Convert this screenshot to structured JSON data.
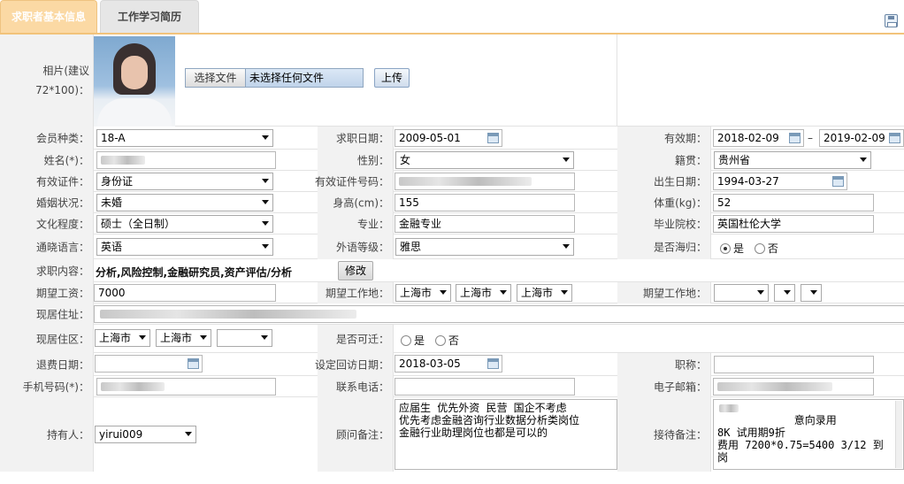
{
  "tabs": {
    "active": "求职者基本信息",
    "inactive": "工作学习简历"
  },
  "photo": {
    "label": "相片(建议72*100)：",
    "choose_button": "选择文件",
    "no_file": "未选择任何文件",
    "upload_button": "上传"
  },
  "labels": {
    "member_type": "会员种类：",
    "job_date": "求职日期：",
    "valid_period": "有效期：",
    "name": "姓名(*)：",
    "gender": "性别：",
    "origin": "籍贯：",
    "id_type": "有效证件：",
    "id_number": "有效证件号码：",
    "birth": "出生日期：",
    "marital": "婚姻状况：",
    "height": "身高(cm)：",
    "weight": "体重(kg)：",
    "education": "文化程度：",
    "major": "专业：",
    "school": "毕业院校：",
    "language": "通晓语言：",
    "lang_level": "外语等级：",
    "overseas": "是否海归：",
    "job_content": "求职内容：",
    "salary": "期望工资：",
    "work_place": "期望工作地：",
    "work_place2": "期望工作地：",
    "address": "现居住址：",
    "district": "现居住区：",
    "relocate": "是否可迁：",
    "refund_date": "退费日期：",
    "revisit_date": "设定回访日期：",
    "title": "职称：",
    "mobile": "手机号码(*)：",
    "phone": "联系电话：",
    "email": "电子邮箱：",
    "holder": "持有人：",
    "advisor_note": "顾问备注：",
    "reception_note": "接待备注："
  },
  "values": {
    "member_type": "18-A",
    "job_date": "2009-05-01",
    "valid_from": "2018-02-09",
    "valid_to": "2019-02-09",
    "gender": "女",
    "origin": "贵州省",
    "id_type": "身份证",
    "birth": "1994-03-27",
    "marital": "未婚",
    "height": "155",
    "weight": "52",
    "education": "硕士（全日制）",
    "major": "金融专业",
    "school": "英国杜伦大学",
    "language": "英语",
    "lang_level": "雅思",
    "yes": "是",
    "no": "否",
    "job_content": "分析,风险控制,金融研究员,资产评估/分析",
    "modify_button": "修改",
    "salary": "7000",
    "wp1": "上海市",
    "wp2": "上海市",
    "wp3": "上海市",
    "d1": "上海市",
    "d2": "上海市",
    "revisit_date": "2018-03-05",
    "holder": "yirui009",
    "advisor_note": "应届生 优先外资 民营 国企不考虑\n优先考虑金融咨询行业数据分析类岗位\n金融行业助理岗位也都是可以的",
    "reception_note": "      意向录用\n8K 试用期9折\n费用 7200*0.75=5400 3/12 到岗"
  }
}
